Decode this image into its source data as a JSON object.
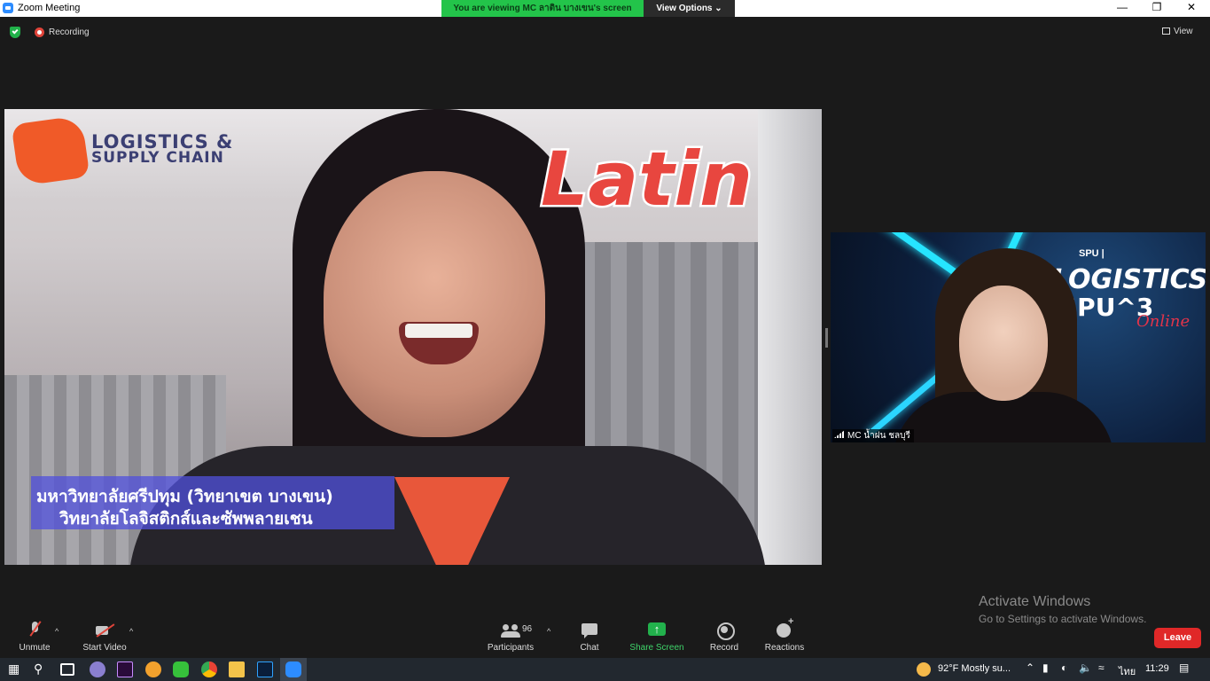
{
  "window": {
    "title": "Zoom Meeting",
    "controls": {
      "minimize": "—",
      "restore": "❐",
      "close": "✕"
    }
  },
  "share_banner": {
    "text": "You are viewing MC ลาติน บางเขน's screen",
    "view_options": "View Options ⌄"
  },
  "status": {
    "recording_label": "Recording",
    "view_label": "View"
  },
  "shared_screen": {
    "logo_line1": "LOGISTICS &",
    "logo_line2": "SUPPLY CHAIN",
    "badge": "Latin",
    "caption_line1": "มหาวิทยาลัยศรีปทุม (วิทยาเขต บางเขน)",
    "caption_line2": "วิทยาลัยโลจิสติกส์และซัพพลายเชน"
  },
  "thumbnail": {
    "participant_name": "MC น้ำฝน ชลบุรี",
    "bg_line1": "SPU | ",
    "bg_line2": "LOGISTICS",
    "bg_line3": "SPU^3",
    "bg_line4": "Online"
  },
  "watermark": {
    "line1": "Activate Windows",
    "line2": "Go to Settings to activate Windows."
  },
  "toolbar": {
    "unmute": "Unmute",
    "start_video": "Start Video",
    "participants": "Participants",
    "participants_count": "96",
    "chat": "Chat",
    "share_screen": "Share Screen",
    "record": "Record",
    "reactions": "Reactions",
    "leave": "Leave",
    "caret": "^"
  },
  "taskbar": {
    "weather": "92°F  Mostly su...",
    "language": "ไทย",
    "time": "11:29"
  },
  "colors": {
    "banner_green": "#23c44a",
    "share_green": "#22b14c",
    "leave_red": "#e02828",
    "recording_red": "#e0443a"
  }
}
